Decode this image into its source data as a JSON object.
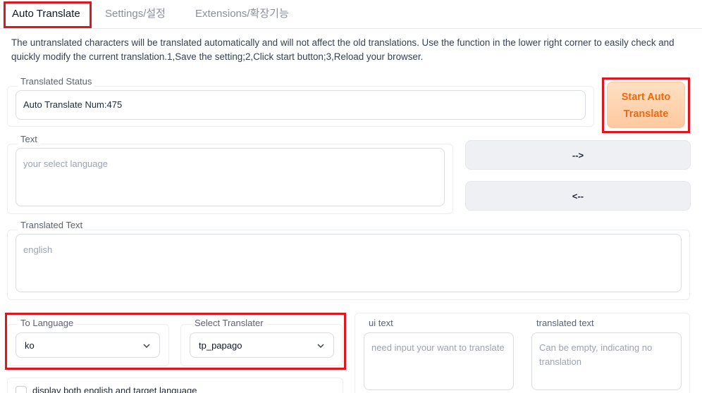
{
  "tabs": [
    {
      "label": "Auto Translate",
      "active": true
    },
    {
      "label": "Settings/설정",
      "active": false
    },
    {
      "label": "Extensions/확장기능",
      "active": false
    }
  ],
  "description": "The untranslated characters will be translated automatically and will not affect the old translations. Use the function in the lower right corner to easily check and quickly modify the current translation.1,Save the setting;2,Click start button;3,Reload your browser.",
  "status": {
    "label": "Translated Status",
    "value": "Auto Translate Num:475"
  },
  "start_button": {
    "line1": "Start Auto",
    "line2": "Translate"
  },
  "text_box": {
    "label": "Text",
    "placeholder": "your select language"
  },
  "arrows": {
    "forward": "-->",
    "backward": "<--"
  },
  "translated_box": {
    "label": "Translated Text",
    "placeholder": "english"
  },
  "to_language": {
    "label": "To Language",
    "value": "ko"
  },
  "translater": {
    "label": "Select Translater",
    "value": "tp_papago"
  },
  "ui_text": {
    "label": "ui text",
    "placeholder": "need input your want to translate"
  },
  "translated_text2": {
    "label": "translated text",
    "placeholder": "Can be empty, indicating no translation"
  },
  "display_option": {
    "label": "display both english and target language"
  },
  "colors": {
    "accent": "#ea6a13",
    "highlight": "#e0161e"
  }
}
